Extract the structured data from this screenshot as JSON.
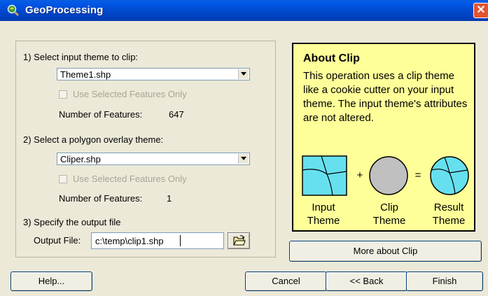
{
  "window": {
    "title": "GeoProcessing",
    "close_glyph": "✕",
    "app_icon": "magnifier-globe-icon"
  },
  "step1": {
    "label": "1) Select input theme to clip:",
    "combo_value": "Theme1.shp",
    "checkbox_label": "Use Selected Features Only",
    "count_label": "Number of Features:",
    "count_value": "647"
  },
  "step2": {
    "label": "2) Select a polygon overlay theme:",
    "combo_value": "Cliper.shp",
    "checkbox_label": "Use Selected Features Only",
    "count_label": "Number of Features:",
    "count_value": "1"
  },
  "step3": {
    "label": "3) Specify the output file",
    "field_label": "Output File:",
    "field_value": "c:\\temp\\clip1.shp",
    "browse_icon": "open-folder-icon"
  },
  "about": {
    "title": "About Clip",
    "body": "This operation uses a clip theme like a cookie cutter on your input theme.  The input theme's attributes are not altered.",
    "plus": "+",
    "equals": "=",
    "captions": {
      "input": "Input\nTheme",
      "clip": "Clip\nTheme",
      "result": "Result\nTheme"
    },
    "colors": {
      "background": "#ffff99",
      "polygon_fill": "#66e0ee",
      "clip_fill": "#c0c0c0"
    }
  },
  "buttons": {
    "more": "More about Clip",
    "help": "Help...",
    "cancel": "Cancel",
    "back": "<< Back",
    "finish": "Finish"
  }
}
